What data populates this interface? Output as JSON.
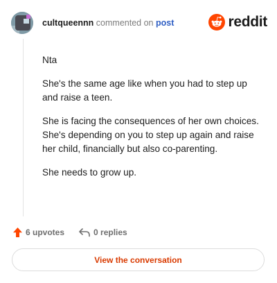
{
  "header": {
    "username": "cultqueennn",
    "action_text": "commented on",
    "post_link": "post",
    "brand_wordmark": "reddit"
  },
  "comment": {
    "paragraphs": [
      "Nta",
      "She's the same age like when you had to step up and raise a teen.",
      "She is facing the consequences of her own choices. She's depending on you to step up again and raise her child, financially but also co-parenting.",
      "She needs to grow up."
    ]
  },
  "actions": {
    "upvotes_label": "6 upvotes",
    "replies_label": "0 replies"
  },
  "view_button": {
    "label": "View the conversation"
  },
  "colors": {
    "brand_orange": "#ff4500",
    "link_blue": "#2f5fc4",
    "button_text": "#d93a00",
    "muted": "#6e6e6e"
  },
  "icons": {
    "avatar": "user-avatar",
    "brand": "reddit-snoo-icon",
    "upvote": "upvote-arrow-icon",
    "reply": "reply-arrow-icon"
  }
}
